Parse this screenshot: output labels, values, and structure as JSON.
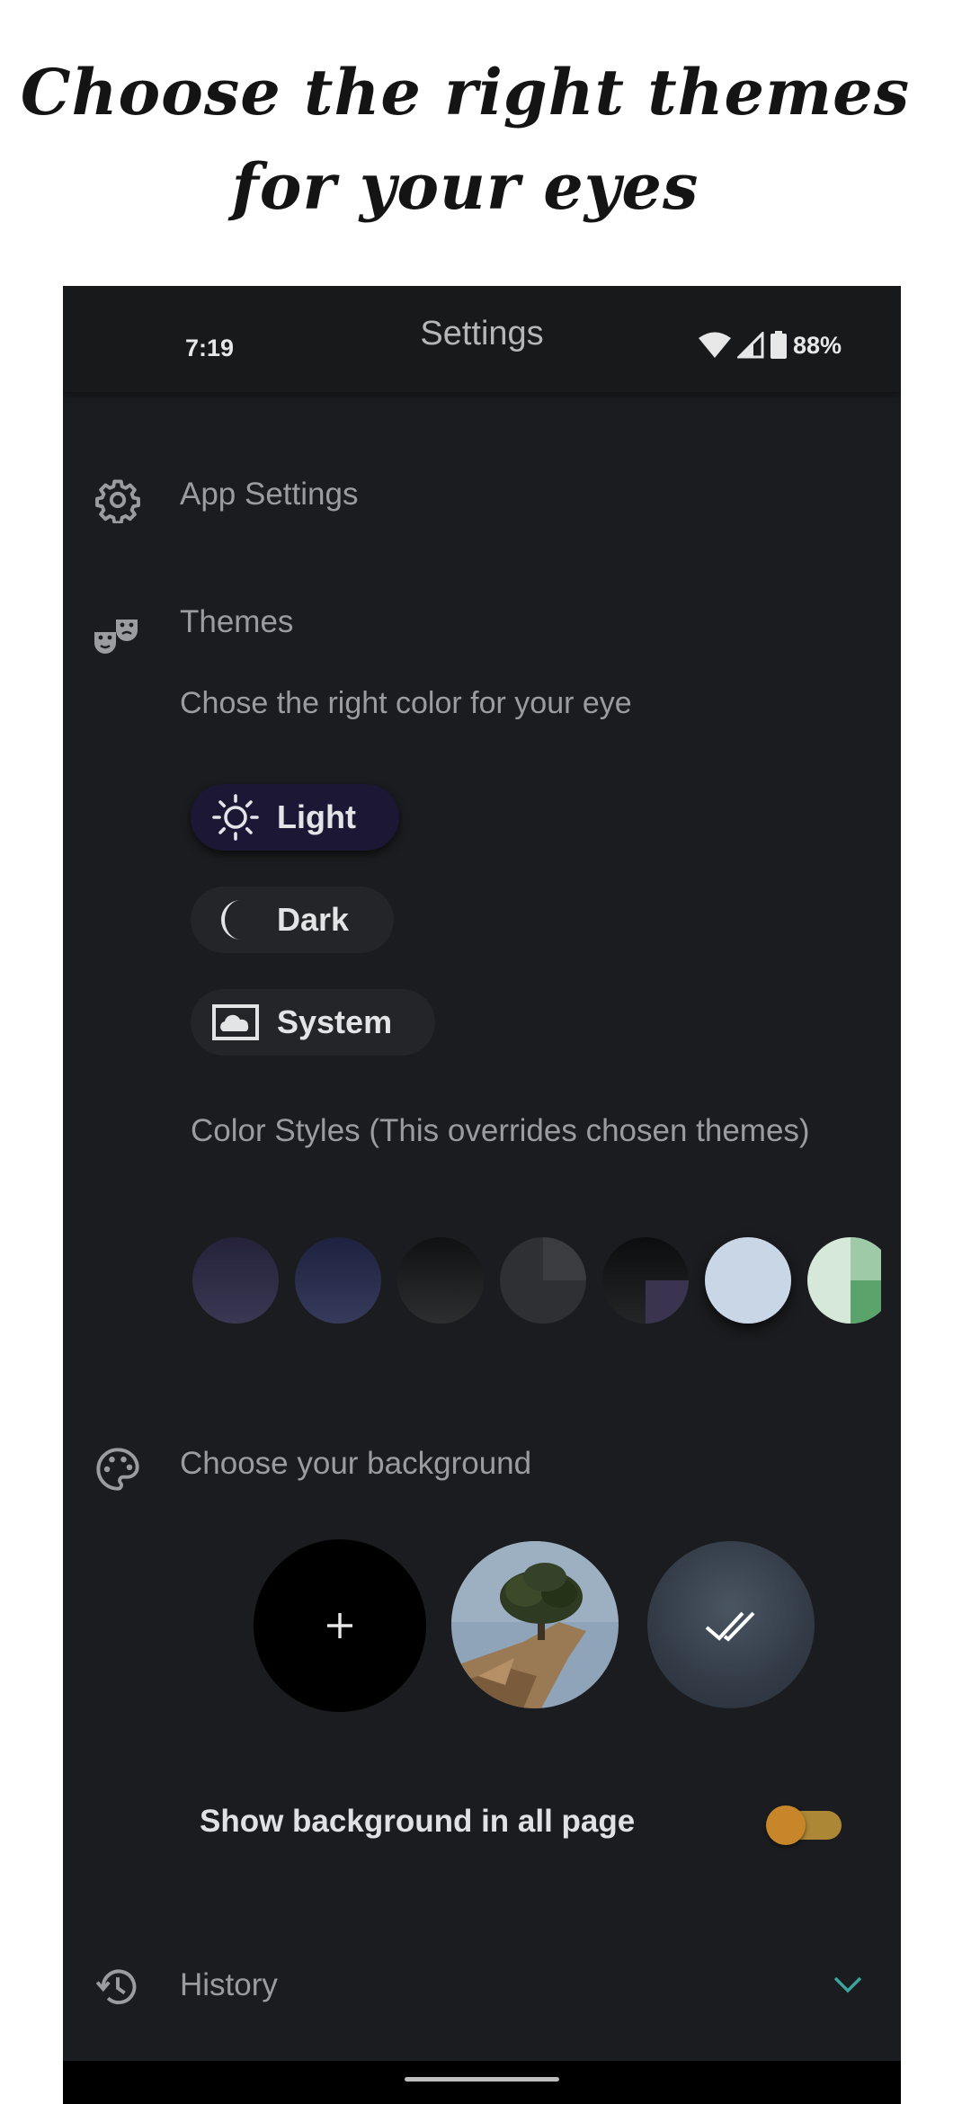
{
  "promo": {
    "line1": "Choose the right themes",
    "line2": "for your eyes"
  },
  "status_bar": {
    "time": "7:19",
    "battery": "88%"
  },
  "app_bar": {
    "title": "Settings"
  },
  "sections": {
    "app_settings": {
      "label": "App Settings",
      "icon": "gear-icon"
    },
    "themes": {
      "label": "Themes",
      "icon": "theater-masks-icon",
      "subtitle": "Chose the right color for your eye",
      "options": [
        {
          "label": "Light",
          "icon": "sun-icon",
          "selected": true
        },
        {
          "label": "Dark",
          "icon": "moon-icon",
          "selected": false
        },
        {
          "label": "System",
          "icon": "picture-icon",
          "selected": false
        }
      ],
      "color_styles_label": "Color Styles (This overrides chosen themes)",
      "swatch_colors": [
        "#2c2a40",
        "#262b44",
        "#1d1e20",
        "#2c2d30",
        "#17181a",
        "#c7d6e6",
        "#cfe3d5"
      ]
    },
    "background": {
      "label": "Choose your background",
      "icon": "palette-icon",
      "add_icon": "plus-icon",
      "selected_icon": "double-check-icon",
      "toggle_label": "Show background in all page",
      "toggle_on": true,
      "toggle_color": "#c8862b"
    },
    "history": {
      "label": "History",
      "icon": "history-icon",
      "expand_icon": "chevron-down-icon"
    }
  }
}
